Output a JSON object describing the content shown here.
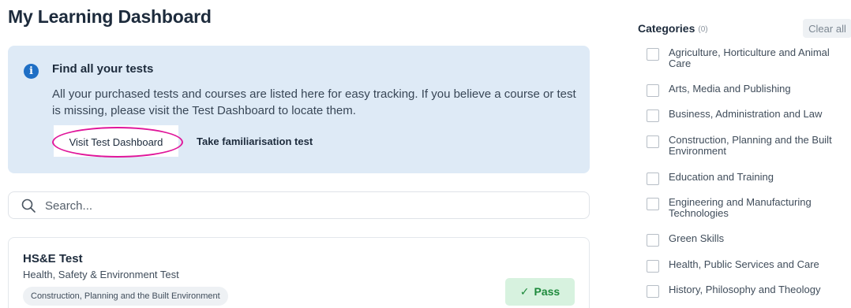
{
  "page": {
    "title": "My Learning Dashboard"
  },
  "info": {
    "icon": "info-icon",
    "title": "Find all your tests",
    "text": "All your purchased tests and courses are listed here for easy tracking. If you believe a course or test is missing, please visit the Test Dashboard to locate them.",
    "visit_button": "Visit Test Dashboard",
    "familiarisation_link": "Take familiarisation test",
    "highlight_color": "#e0169a"
  },
  "search": {
    "placeholder": "Search..."
  },
  "courses": [
    {
      "title": "HS&E Test",
      "subtitle": "Health, Safety & Environment Test",
      "tag": "Construction, Planning and the Built Environment",
      "status": "Pass",
      "status_icon": "check-icon"
    }
  ],
  "categories": {
    "title": "Categories",
    "count": "(0)",
    "clear_all": "Clear all",
    "items": [
      "Agriculture, Horticulture and Animal Care",
      "Arts, Media and Publishing",
      "Business, Administration and Law",
      "Construction, Planning and the Built Environment",
      "Education and Training",
      "Engineering and Manufacturing Technologies",
      "Green Skills",
      "Health, Public Services and Care",
      "History, Philosophy and Theology"
    ]
  },
  "colors": {
    "info_bg": "#deeaf6",
    "accent_blue": "#1f6fc5",
    "pass_bg": "#d7f2df",
    "pass_text": "#1e8a3c"
  }
}
